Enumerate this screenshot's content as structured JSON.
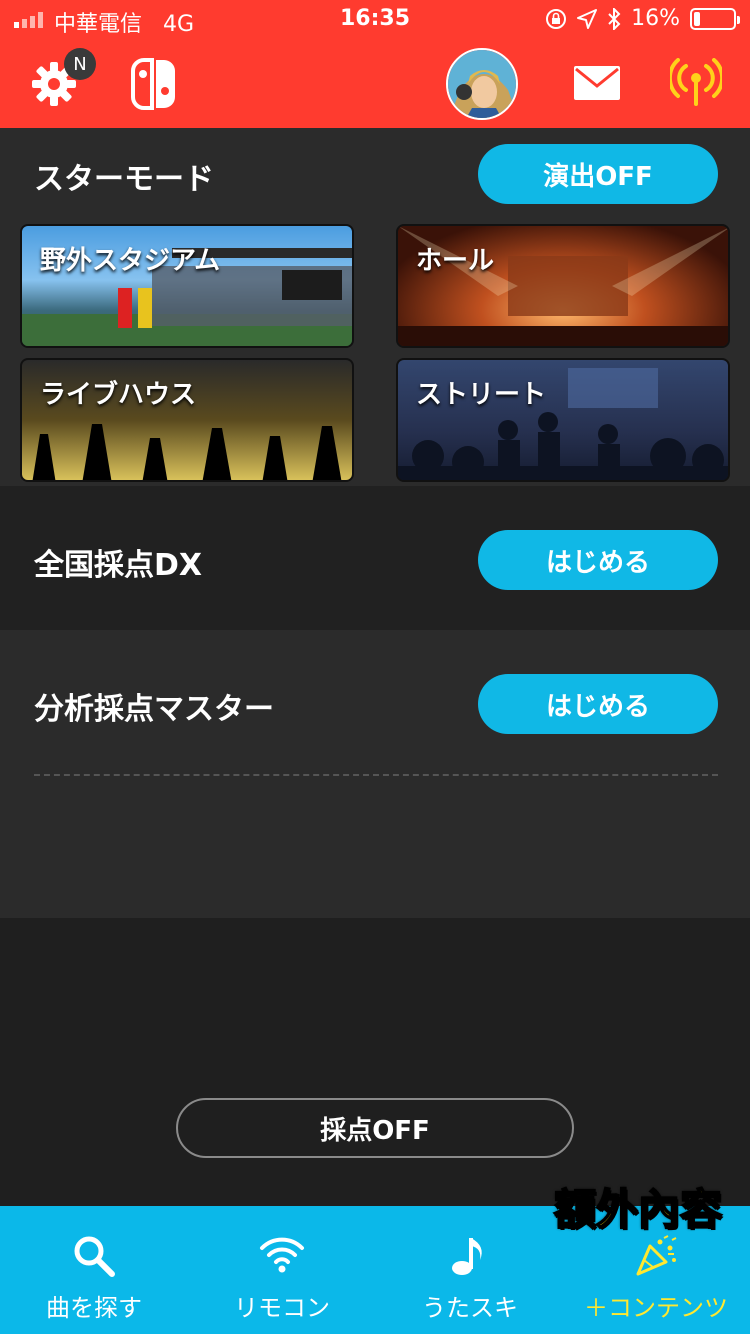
{
  "status_bar": {
    "carrier": "中華電信",
    "network": "4G",
    "time": "16:35",
    "battery": "16%"
  },
  "top_bar": {
    "notification_badge": "N",
    "icons": [
      "gear-icon",
      "switch-icon",
      "avatar",
      "mail-icon",
      "antenna-icon"
    ]
  },
  "star_mode": {
    "title": "スターモード",
    "toggle_label": "演出OFF",
    "stages": [
      {
        "label": "野外スタジアム"
      },
      {
        "label": "ホール"
      },
      {
        "label": "ライブハウス"
      },
      {
        "label": "ストリート"
      }
    ]
  },
  "scoring": {
    "dx": {
      "title": "全国採点DX",
      "button": "はじめる"
    },
    "master": {
      "title": "分析採点マスター",
      "button": "はじめる"
    },
    "off_button": "採点OFF"
  },
  "tabs": [
    {
      "label": "曲を探す",
      "icon": "search-icon"
    },
    {
      "label": "リモコン",
      "icon": "wifi-icon"
    },
    {
      "label": "うたスキ",
      "icon": "music-note-icon"
    },
    {
      "label": "＋コンテンツ",
      "icon": "party-popper-icon",
      "active": true
    }
  ],
  "overlay_text": "額外內容",
  "colors": {
    "top_bar": "#ff3b2f",
    "accent_blue": "#10b8e6",
    "active_tab": "#ffe830"
  }
}
